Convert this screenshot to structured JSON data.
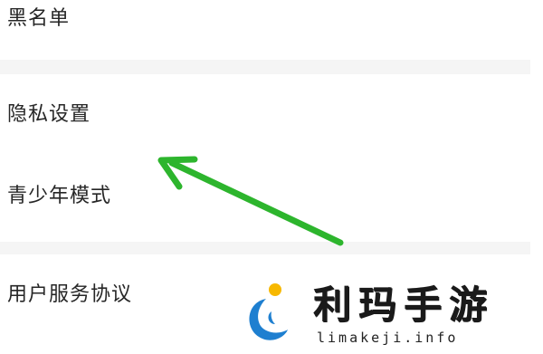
{
  "settings": {
    "items": [
      {
        "label": "黑名单"
      },
      {
        "label": "隐私设置"
      },
      {
        "label": "青少年模式"
      },
      {
        "label": "用户服务协议"
      }
    ]
  },
  "annotation": {
    "arrow_color": "#2db52d"
  },
  "watermark": {
    "title": "利玛手游",
    "url": "limakeji.info",
    "logo_colors": {
      "sun": "#f7b800",
      "wave": "#1e7fd0"
    }
  }
}
